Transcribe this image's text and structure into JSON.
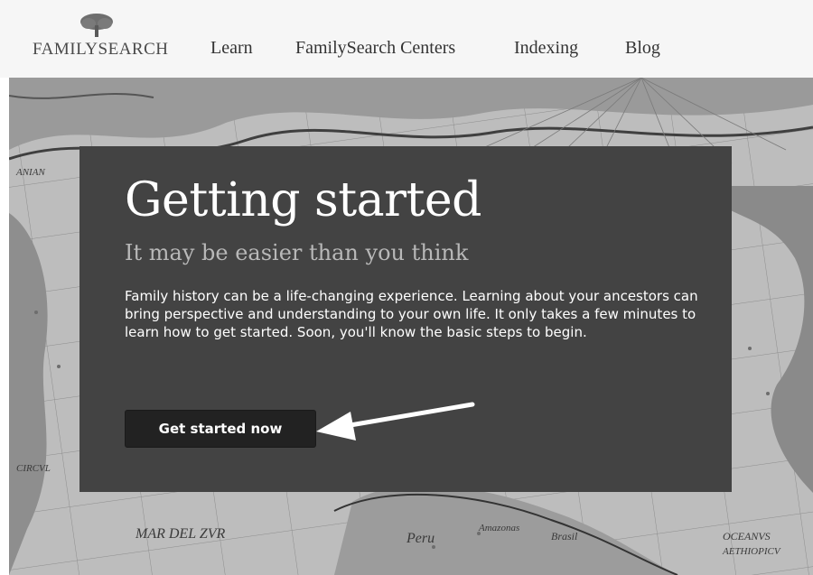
{
  "header": {
    "logo_text": "FAMILYSEARCH",
    "nav": [
      {
        "label": "Learn"
      },
      {
        "label": "FamilySearch Centers"
      },
      {
        "label": "Indexing"
      },
      {
        "label": "Blog"
      }
    ]
  },
  "map": {
    "labels": [
      "ANIAN",
      "CIRCVL",
      "MAR DEL ZVR",
      "Peru",
      "Amazonas",
      "Brasil",
      "OCEANVS",
      "AETHIOPICV"
    ]
  },
  "hero": {
    "title": "Getting started",
    "subtitle": "It may be easier than you think",
    "body": "Family history can be a life-changing experience. Learning about your ancestors can bring perspective and understanding to your own life. It only takes a few minutes to learn how to get started. Soon, you'll know the basic steps to begin.",
    "cta_label": "Get started now"
  },
  "colors": {
    "panel": "#434343",
    "button": "#222222",
    "subtitle": "#b8b8b8",
    "annotation_arrow": "#ffffff"
  },
  "icons": [
    "family-tree-logo-icon",
    "annotation-arrow-icon"
  ]
}
